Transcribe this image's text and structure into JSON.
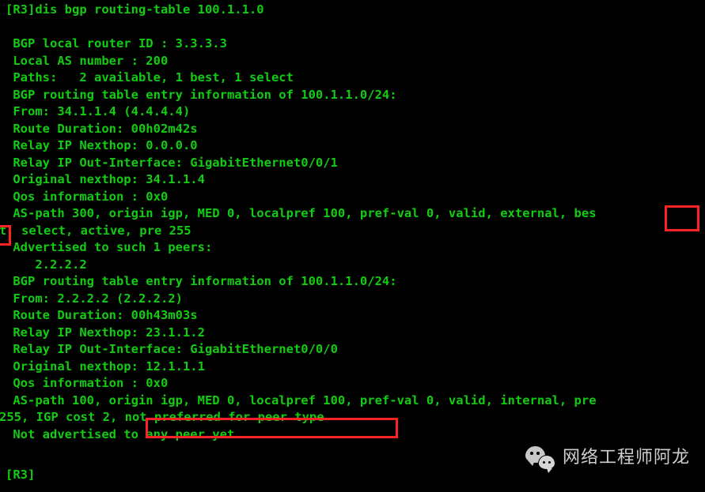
{
  "terminal": {
    "background_color": "#000000",
    "text_color": "#12cc12",
    "annotation_color": "#fb2323",
    "prompt_top": "[R3]dis bgp routing-table 100.1.1.0",
    "prompt_bottom": "[R3]",
    "lines": [
      "[R3]dis bgp routing-table 100.1.1.0",
      "",
      " BGP local router ID : 3.3.3.3",
      " Local AS number : 200",
      " Paths:   2 available, 1 best, 1 select",
      " BGP routing table entry information of 100.1.1.0/24:",
      " From: 34.1.1.4 (4.4.4.4)",
      " Route Duration: 00h02m42s",
      " Relay IP Nexthop: 0.0.0.0",
      " Relay IP Out-Interface: GigabitEthernet0/0/1",
      " Original nexthop: 34.1.1.4",
      " Qos information : 0x0",
      " AS-path 300, origin igp, MED 0, localpref 100, pref-val 0, valid, external, bes",
      "t, select, active, pre 255",
      " Advertised to such 1 peers:",
      "    2.2.2.2",
      " BGP routing table entry information of 100.1.1.0/24:",
      " From: 2.2.2.2 (2.2.2.2)",
      " Route Duration: 00h43m03s",
      " Relay IP Nexthop: 23.1.1.2",
      " Relay IP Out-Interface: GigabitEthernet0/0/0",
      " Original nexthop: 12.1.1.1",
      " Qos information : 0x0",
      " AS-path 100, origin igp, MED 0, localpref 100, pref-val 0, valid, internal, pre",
      "255, IGP cost 2, not preferred for peer type",
      " Not advertised to any peer yet",
      "",
      "[R3]"
    ]
  },
  "annotations": {
    "highlight_best_right": "bes",
    "highlight_best_left": "t",
    "highlight_not_preferred": "not preferred for peer type"
  },
  "watermark": {
    "icon": "wechat-icon",
    "text": "网络工程师阿龙"
  }
}
